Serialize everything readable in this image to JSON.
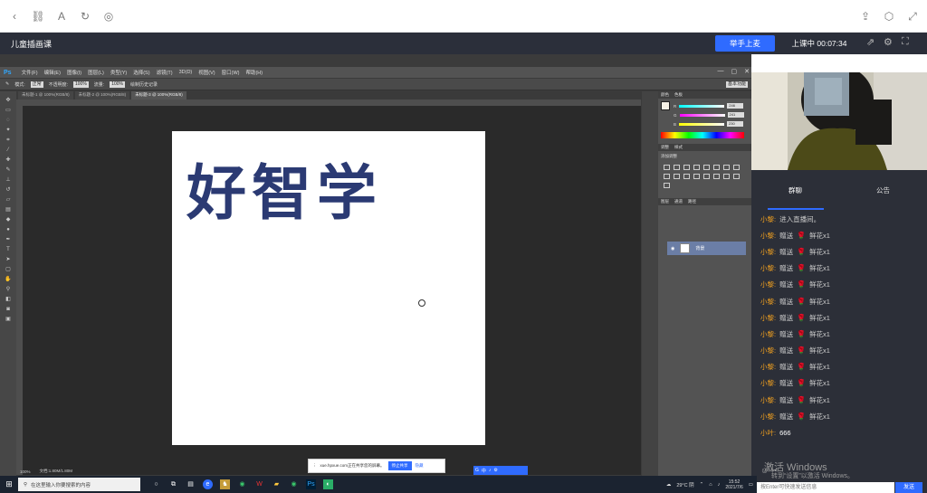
{
  "browser": {
    "icons": [
      "back-icon",
      "link-icon",
      "font-size-icon",
      "reload-icon",
      "compass-icon",
      "share-icon",
      "box-icon",
      "fullscreen-icon"
    ]
  },
  "header": {
    "title": "儿童插画课",
    "raise_hand": "举手上麦",
    "live_status": "上课中 00:07:34"
  },
  "ps": {
    "logo": "Ps",
    "menu": [
      "文件(F)",
      "编辑(E)",
      "图像(I)",
      "图层(L)",
      "类型(Y)",
      "选择(S)",
      "滤镜(T)",
      "3D(D)",
      "视图(V)",
      "窗口(W)",
      "帮助(H)"
    ],
    "window_controls": [
      "—",
      "▢",
      "✕"
    ],
    "options": {
      "brush_label": "模式:",
      "mode": "正常",
      "opacity_label": "不透明度:",
      "opacity": "100%",
      "flow_label": "流量:",
      "flow": "100%",
      "history": "绘制历史记录",
      "workspace": "基本功能"
    },
    "tabs": [
      "未标题-1 @ 100%(RGB/8)",
      "未标题-2 @ 100%(RGB/8)",
      "未标题-3 @ 100%(RGB/8)"
    ],
    "canvas_text": "好智学",
    "canvas_text_color": "#2b3a73",
    "status": {
      "zoom": "100%",
      "doc": "文档:1.80M/1.80M"
    },
    "panels": {
      "color_tabs": [
        "颜色",
        "色板"
      ],
      "rgb": [
        {
          "ch": "R",
          "val": "246"
        },
        {
          "ch": "G",
          "val": "241"
        },
        {
          "ch": "B",
          "val": "230"
        }
      ],
      "adj_tabs": [
        "调整",
        "样式"
      ],
      "adj_title": "添加调整",
      "layer_tabs": [
        "图层",
        "通道",
        "路径"
      ],
      "layer_name": "背景"
    }
  },
  "chat": {
    "tabs": [
      "群聊",
      "公告"
    ],
    "messages": [
      {
        "who": "小黎:",
        "text": "进入直播间。",
        "gift": false
      },
      {
        "who": "小黎:",
        "text": "赠送",
        "gift": true,
        "gift_name": "鲜花x1"
      },
      {
        "who": "小黎:",
        "text": "赠送",
        "gift": true,
        "gift_name": "鲜花x1"
      },
      {
        "who": "小黎:",
        "text": "赠送",
        "gift": true,
        "gift_name": "鲜花x1"
      },
      {
        "who": "小黎:",
        "text": "赠送",
        "gift": true,
        "gift_name": "鲜花x1"
      },
      {
        "who": "小黎:",
        "text": "赠送",
        "gift": true,
        "gift_name": "鲜花x1"
      },
      {
        "who": "小黎:",
        "text": "赠送",
        "gift": true,
        "gift_name": "鲜花x1"
      },
      {
        "who": "小黎:",
        "text": "赠送",
        "gift": true,
        "gift_name": "鲜花x1"
      },
      {
        "who": "小黎:",
        "text": "赠送",
        "gift": true,
        "gift_name": "鲜花x1"
      },
      {
        "who": "小黎:",
        "text": "赠送",
        "gift": true,
        "gift_name": "鲜花x1"
      },
      {
        "who": "小黎:",
        "text": "赠送",
        "gift": true,
        "gift_name": "鲜花x1"
      },
      {
        "who": "小黎:",
        "text": "赠送",
        "gift": true,
        "gift_name": "鲜花x1"
      },
      {
        "who": "小黎:",
        "text": "赠送",
        "gift": true,
        "gift_name": "鲜花x1"
      },
      {
        "who": "小叶:",
        "text": "666",
        "gift": false
      }
    ],
    "watermark": "激活 Windows",
    "watermark_sub": "转到“设置”以激活 Windows。",
    "input_placeholder": "按Enter可快速发送信息",
    "send": "发送"
  },
  "share_bar": {
    "text": "xue.hpxue.com正在共享您的屏幕。",
    "stop": "停止共享",
    "hide": "隐藏"
  },
  "ime": {
    "items": [
      "G",
      "中",
      "♪",
      "⚙"
    ]
  },
  "taskbar": {
    "search": "在这里输入你要搜索的内容",
    "weather": "29°C 阴",
    "time": "15:52",
    "date": "2021/7/6"
  }
}
